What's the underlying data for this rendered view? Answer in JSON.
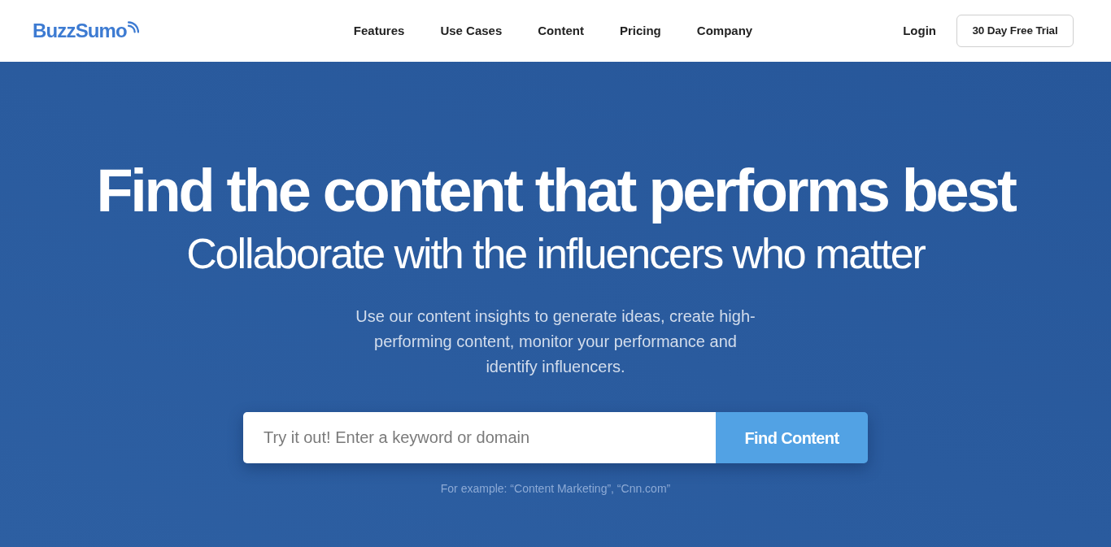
{
  "header": {
    "logo": "BuzzSumo",
    "nav": [
      "Features",
      "Use Cases",
      "Content",
      "Pricing",
      "Company"
    ],
    "login": "Login",
    "trial_button": "30 Day Free Trial"
  },
  "hero": {
    "title": "Find the content that performs best",
    "subtitle": "Collaborate with the influencers who matter",
    "description": "Use our content insights to generate ideas, create high-performing content, monitor your performance and identify influencers.",
    "search": {
      "placeholder": "Try it out! Enter a keyword or domain",
      "button": "Find Content"
    },
    "example": "For example: “Content Marketing”, “Cnn.com”"
  }
}
